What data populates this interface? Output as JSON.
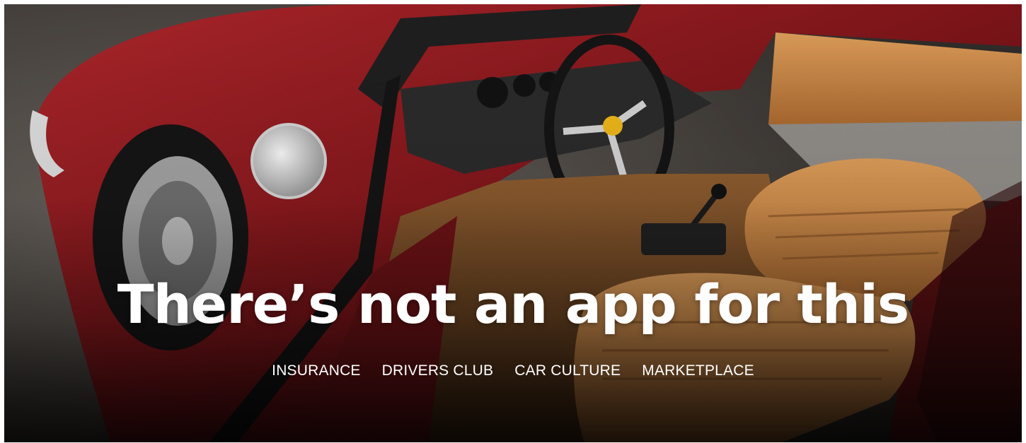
{
  "hero": {
    "headline": "There’s not an app for this",
    "image_subject": "red classic sports car with open door, tan leather interior"
  },
  "nav": {
    "items": [
      {
        "label": "INSURANCE"
      },
      {
        "label": "DRIVERS CLUB"
      },
      {
        "label": "CAR CULTURE"
      },
      {
        "label": "MARKETPLACE"
      }
    ]
  },
  "colors": {
    "car_red": "#7a1418",
    "leather_tan": "#c98a4a",
    "text": "#ffffff"
  }
}
